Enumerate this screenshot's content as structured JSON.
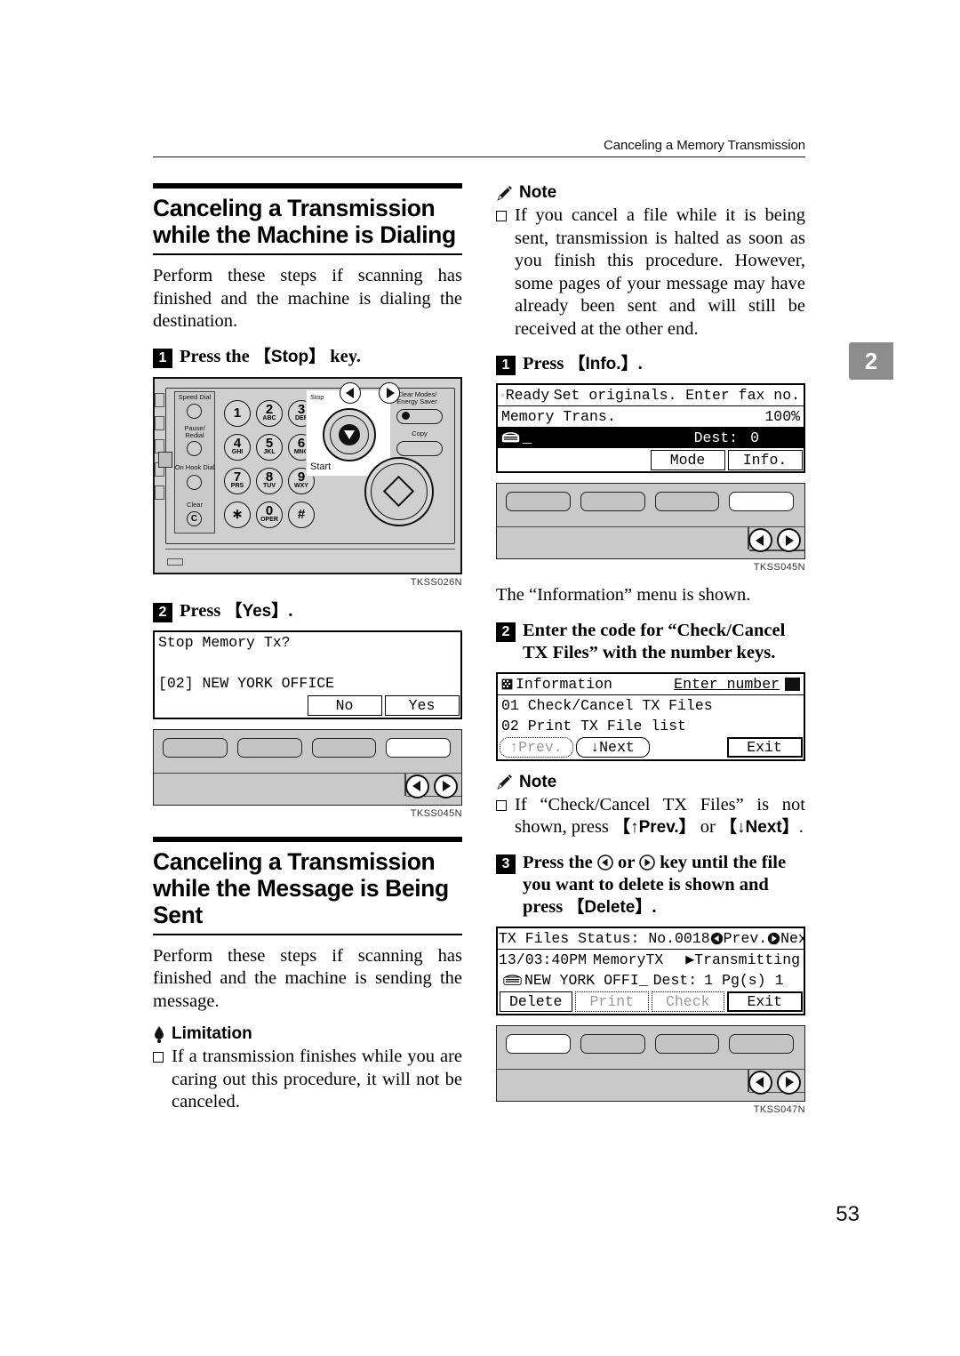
{
  "header": {
    "running_title": "Canceling a Memory Transmission"
  },
  "side_tab": {
    "number": "2"
  },
  "page_number": "53",
  "left_column": {
    "section1": {
      "heading": "Canceling a Transmission while the Machine is Dialing",
      "intro": "Perform these steps if scanning has finished and the machine is dialing the destination.",
      "step1": {
        "num": "1",
        "text_before": "Press the ",
        "key": "Stop",
        "text_after": " key."
      },
      "figure1": {
        "code": "TKSS026N",
        "labels": {
          "speed_dial": "Speed Dial",
          "pause_redial": "Pause/ Redial",
          "on_hook_dial": "On Hook Dial",
          "clear": "Clear",
          "clear_glyph": "C",
          "stop": "Stop",
          "start": "Start",
          "clear_modes": "Clear Modes/ Energy Saver",
          "copy": "Copy"
        },
        "keys": [
          {
            "big": "1",
            "sub": ""
          },
          {
            "big": "2",
            "sub": "ABC"
          },
          {
            "big": "3",
            "sub": "DEF"
          },
          {
            "big": "4",
            "sub": "GHI"
          },
          {
            "big": "5",
            "sub": "JKL"
          },
          {
            "big": "6",
            "sub": "MNO"
          },
          {
            "big": "7",
            "sub": "PRS"
          },
          {
            "big": "8",
            "sub": "TUV"
          },
          {
            "big": "9",
            "sub": "WXY"
          },
          {
            "big": "∗",
            "sub": ""
          },
          {
            "big": "0",
            "sub": "OPER"
          },
          {
            "big": "#",
            "sub": ""
          }
        ]
      },
      "step2": {
        "num": "2",
        "text_before": "Press ",
        "key": "Yes",
        "text_after": "."
      },
      "lcd1": {
        "line1": "Stop Memory Tx?",
        "line2": "",
        "line3": "[02] NEW YORK OFFICE",
        "softkeys": [
          "",
          "",
          "No",
          "Yes"
        ]
      },
      "figure2": {
        "code": "TKSS045N",
        "highlighted_softkey_index": 3
      }
    },
    "section2": {
      "heading": "Canceling a Transmission while the Message is Being Sent",
      "intro": "Perform these steps if scanning has finished and the machine is sending the message.",
      "limitation_label": "Limitation",
      "limitation_text": "If a transmission finishes while you are caring out this procedure, it will not be canceled."
    }
  },
  "right_column": {
    "note1": {
      "label": "Note",
      "text": "If you cancel a file while it is being sent, transmission is halted as soon as you finish this procedure. However, some pages of your message may have already been sent and will still be received at the other end."
    },
    "step1": {
      "num": "1",
      "text_before": "Press ",
      "key": "Info.",
      "text_after": "."
    },
    "lcd_ready": {
      "status": "Ready",
      "prompt": "Set originals. Enter fax no.",
      "mode": "Memory Trans.",
      "percent": "100%",
      "entry": "_",
      "dest_label": "Dest:",
      "dest_value": "0",
      "softkeys": [
        "",
        "",
        "Mode",
        "Info."
      ]
    },
    "figure_ready": {
      "code": "TKSS045N",
      "highlighted_softkey_index": 3
    },
    "caption1": "The “Information” menu is shown.",
    "step2": {
      "num": "2",
      "text": "Enter the code for “Check/Cancel TX Files” with the number keys."
    },
    "lcd_information": {
      "title": "Information",
      "hint": "Enter number",
      "items": [
        "01 Check/Cancel TX Files",
        "02 Print TX File list"
      ],
      "softkeys": [
        "↑Prev.",
        "↓Next",
        "",
        "Exit"
      ],
      "disabled_softkeys": [
        0
      ]
    },
    "note2": {
      "label": "Note",
      "text_part1": "If “Check/Cancel TX Files” is not shown, press ",
      "key1": "↑Prev.",
      "text_part2": " or ",
      "key2": "↓Next",
      "text_part3": "."
    },
    "step3": {
      "num": "3",
      "text_before": "Press the ",
      "text_mid": " or ",
      "text_after": " key until the file you want to delete is shown and press ",
      "key": "Delete",
      "text_end": "."
    },
    "lcd_txfiles": {
      "title": "TX Files Status: No.0018",
      "prev": "Prev.",
      "next": "Next",
      "time": "13/03:40PM",
      "type": "MemoryTX",
      "state": "Transmitting",
      "dest_name": "NEW YORK OFFI",
      "dest_label": "Dest:",
      "dest_value": "1",
      "pages_label": "Pg(s)",
      "pages_value": "1",
      "softkeys": [
        "Delete",
        "Print",
        "Check",
        "Exit"
      ],
      "disabled_softkeys": [
        1,
        2
      ]
    },
    "figure_txfiles": {
      "code": "TKSS047N",
      "highlighted_softkey_index": 0
    }
  }
}
